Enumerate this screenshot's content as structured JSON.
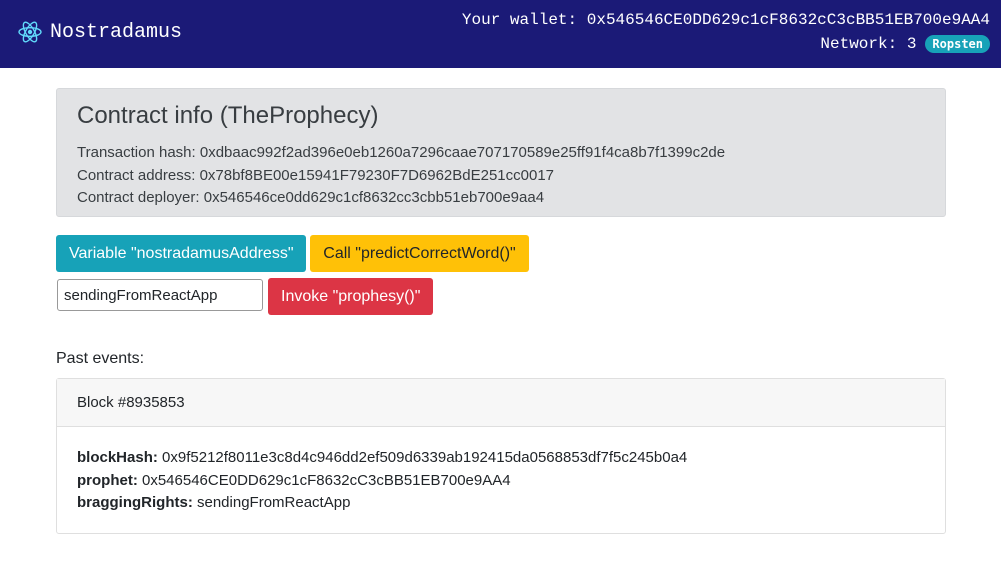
{
  "navbar": {
    "brand": "Nostradamus",
    "wallet_label": "Your wallet:",
    "wallet_address": "0x546546CE0DD629c1cF8632cC3cBB51EB700e9AA4",
    "network_label": "Network:",
    "network_id": "3",
    "network_name": "Ropsten"
  },
  "contract_info": {
    "title": "Contract info (TheProphecy)",
    "tx_hash_label": "Transaction hash:",
    "tx_hash": "0xdbaac992f2ad396e0eb1260a7296caae707170589e25ff91f4ca8b7f1399c2de",
    "address_label": "Contract address:",
    "address": "0x78bf8BE00e15941F79230F7D6962BdE251cc0017",
    "deployer_label": "Contract deployer:",
    "deployer": "0x546546ce0dd629c1cf8632cc3cbb51eb700e9aa4"
  },
  "actions": {
    "variable_button": "Variable \"nostradamusAddress\"",
    "call_button": "Call \"predictCorrectWord()\"",
    "input_value": "sendingFromReactApp",
    "invoke_button": "Invoke \"prophesy()\""
  },
  "events": {
    "label": "Past events:",
    "items": [
      {
        "block": "Block #8935853",
        "block_hash_key": "blockHash:",
        "block_hash": "0x9f5212f8011e3c8d4c946dd2ef509d6339ab192415da0568853df7f5c245b0a4",
        "prophet_key": "prophet:",
        "prophet": "0x546546CE0DD629c1cF8632cC3cBB51EB700e9AA4",
        "bragging_key": "braggingRights:",
        "bragging": "sendingFromReactApp"
      }
    ]
  },
  "colors": {
    "navbar": "#1b1a77",
    "info": "#17a2b8",
    "warning": "#ffc107",
    "danger": "#dc3545",
    "jumbotron": "#e2e3e5"
  },
  "icons": {
    "brand_logo": "react-atom-icon"
  }
}
